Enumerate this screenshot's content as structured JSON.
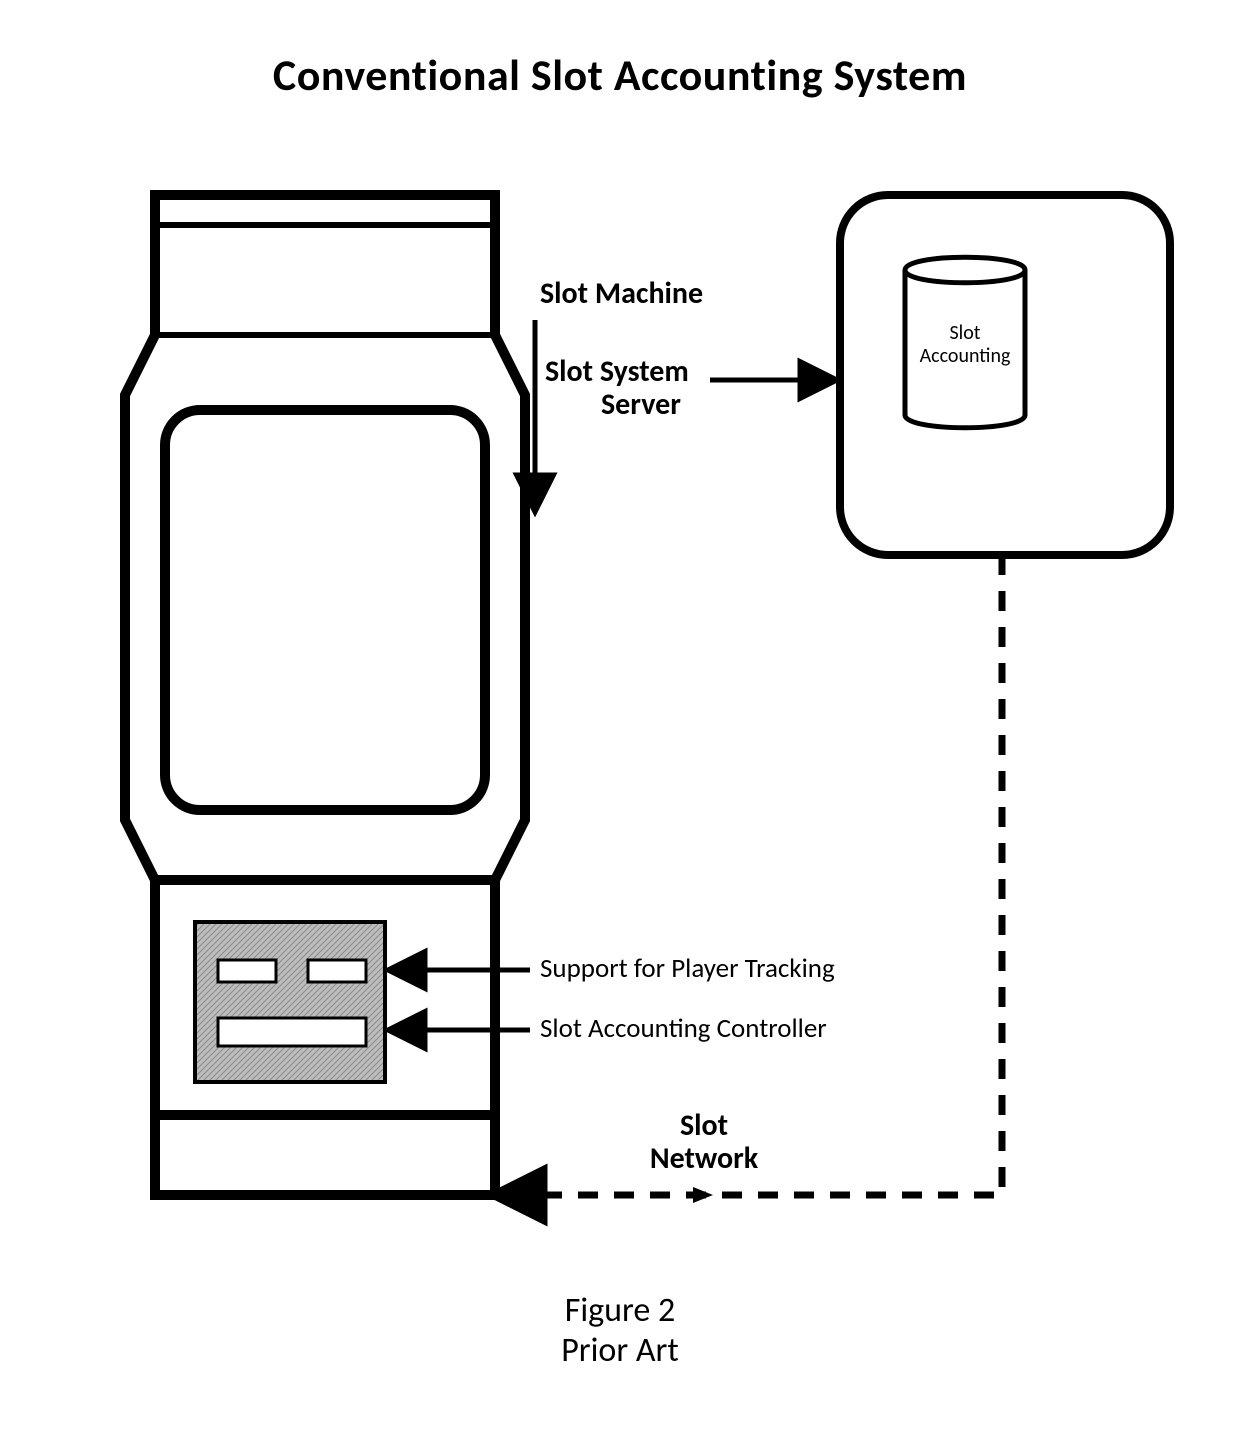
{
  "title": "Conventional Slot Accounting System",
  "labels": {
    "slot_machine": "Slot Machine",
    "slot_system_server_l1": "Slot System",
    "slot_system_server_l2": "Server",
    "support_player_tracking": "Support for Player Tracking",
    "slot_accounting_controller": "Slot Accounting Controller",
    "slot_network_l1": "Slot",
    "slot_network_l2": "Network",
    "cylinder_l1": "Slot",
    "cylinder_l2": "Accounting"
  },
  "figure": {
    "caption": "Figure 2",
    "subcaption": "Prior Art"
  }
}
